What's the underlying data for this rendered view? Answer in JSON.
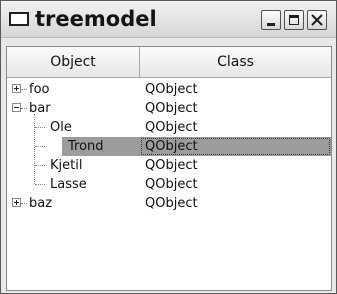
{
  "window": {
    "title": "treemodel"
  },
  "columns": {
    "object": "Object",
    "class": "Class"
  },
  "rows": [
    {
      "name": "foo",
      "cls": "QObject",
      "level": 0,
      "expander": "plus",
      "selected": false
    },
    {
      "name": "bar",
      "cls": "QObject",
      "level": 0,
      "expander": "minus",
      "selected": false
    },
    {
      "name": "Ole",
      "cls": "QObject",
      "level": 1,
      "expander": "none",
      "selected": false
    },
    {
      "name": "Trond",
      "cls": "QObject",
      "level": 1,
      "expander": "none",
      "selected": true
    },
    {
      "name": "Kjetil",
      "cls": "QObject",
      "level": 1,
      "expander": "none",
      "selected": false
    },
    {
      "name": "Lasse",
      "cls": "QObject",
      "level": 1,
      "expander": "none",
      "selected": false
    },
    {
      "name": "baz",
      "cls": "QObject",
      "level": 0,
      "expander": "plus",
      "selected": false
    }
  ],
  "colors": {
    "selection": "#9c9c9c",
    "window_bg": "#e8e8e8",
    "view_bg": "#ffffff"
  },
  "icons": {
    "app": "window-icon",
    "minimize": "minimize-icon",
    "maximize": "maximize-icon",
    "close": "close-icon",
    "expand": "plus-icon",
    "collapse": "minus-icon"
  }
}
